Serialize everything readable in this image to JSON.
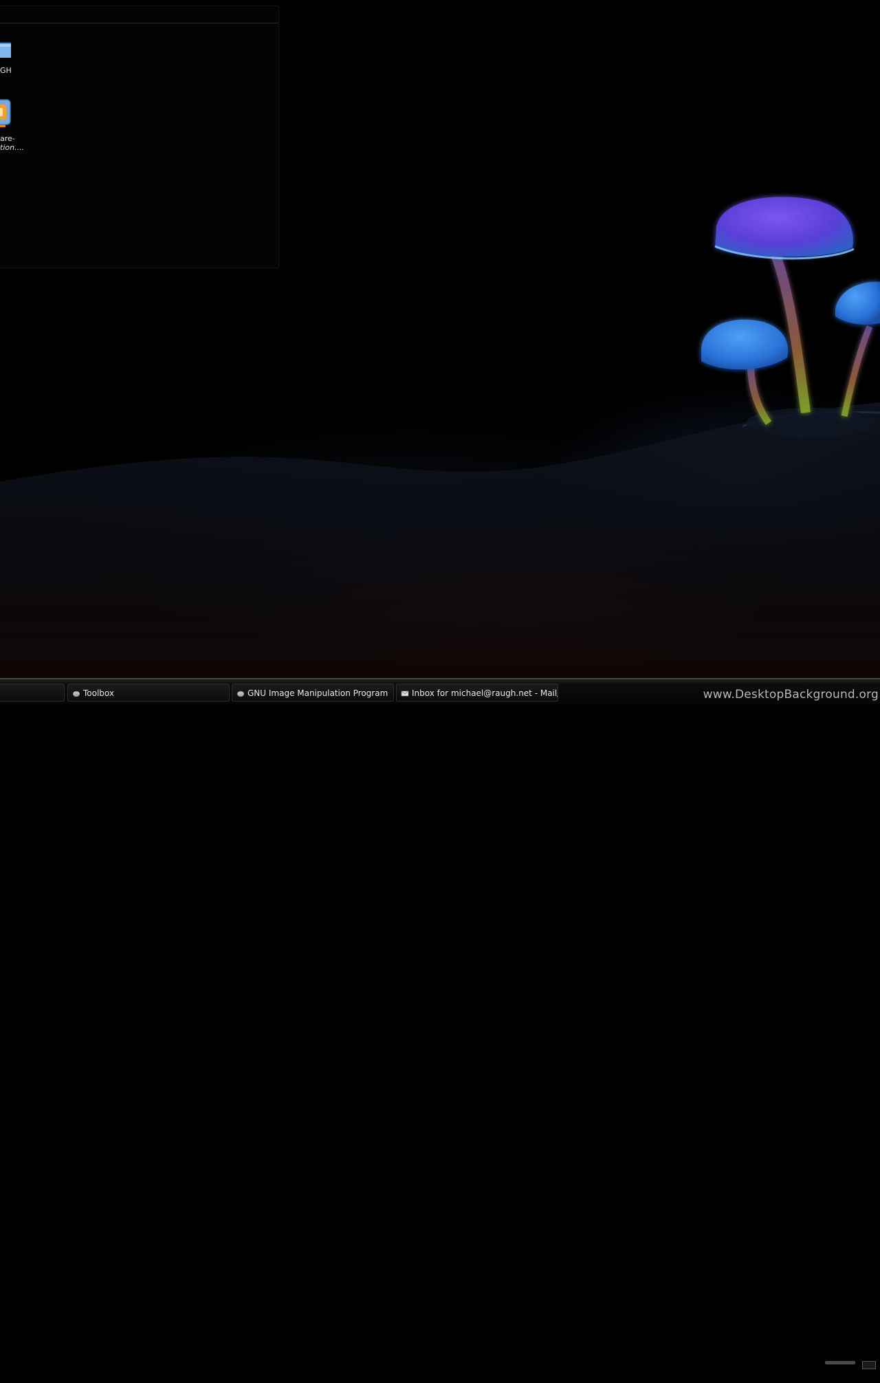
{
  "desktop": {
    "icons": [
      {
        "label": "GH",
        "icon": "folder-icon"
      },
      {
        "label_line1": "are-",
        "label_line2": "tion....",
        "icon": "package-icon"
      }
    ]
  },
  "taskbar": {
    "tasks": [
      {
        "label": "",
        "icon": ""
      },
      {
        "label": "Toolbox",
        "icon": "gimp-icon"
      },
      {
        "label": "GNU Image Manipulation Program",
        "icon": "gimp-icon"
      },
      {
        "label": "Inbox for michael@raugh.net - Mail/Ne",
        "icon": "mail-icon"
      }
    ]
  },
  "watermark": "www.DesktopBackground.org",
  "colors": {
    "background": "#000000",
    "taskbar": "#0c0c0c",
    "mushroom_purple": "#6a3fe0",
    "mushroom_blue": "#2f7fe0"
  }
}
